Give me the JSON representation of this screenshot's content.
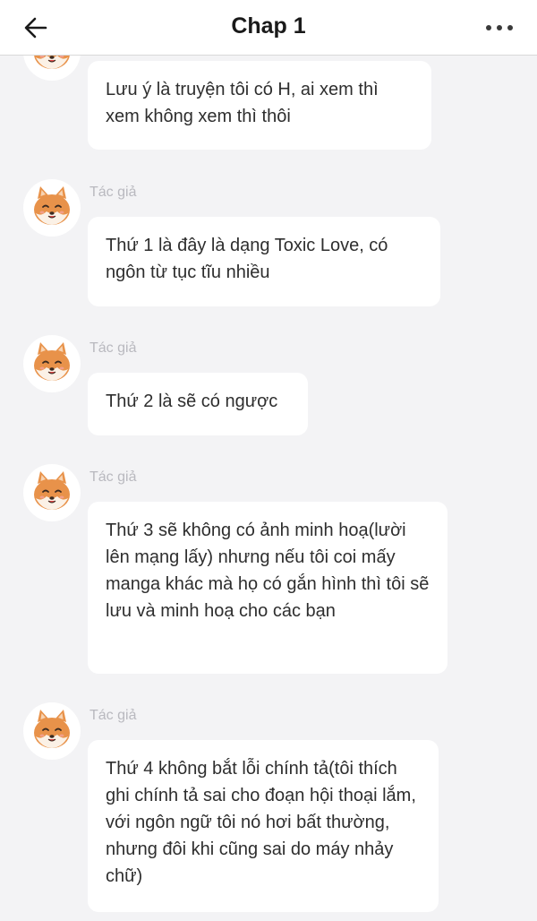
{
  "header": {
    "title": "Chap 1",
    "back_icon": "arrow-left-icon",
    "more_icon": "more-horizontal-icon"
  },
  "colors": {
    "background": "#f3f3f5",
    "bubble": "#ffffff",
    "author_label": "#b9b9bf",
    "avatar_fur": "#e8924a"
  },
  "messages": [
    {
      "author": "",
      "text": "Lưu ý là truyện tôi có H, ai xem thì xem không xem thì thôi"
    },
    {
      "author": "Tác giả",
      "text": "Thứ 1 là đây là dạng Toxic Love, có ngôn từ tục tĩu nhiều"
    },
    {
      "author": "Tác giả",
      "text": "Thứ 2 là sẽ có ngược"
    },
    {
      "author": "Tác giả",
      "text": "Thứ 3 sẽ không có ảnh minh hoạ(lười lên mạng lấy) nhưng nếu tôi coi mấy manga khác mà họ có gắn hình thì tôi sẽ lưu và minh hoạ cho các bạn"
    },
    {
      "author": "Tác giả",
      "text": "Thứ 4 không bắt lỗi chính tả(tôi thích ghi chính tả sai cho đoạn hội thoại lắm, với ngôn ngữ tôi nó hơi bất thường, nhưng đôi khi cũng sai do máy nhảy chữ)"
    }
  ]
}
